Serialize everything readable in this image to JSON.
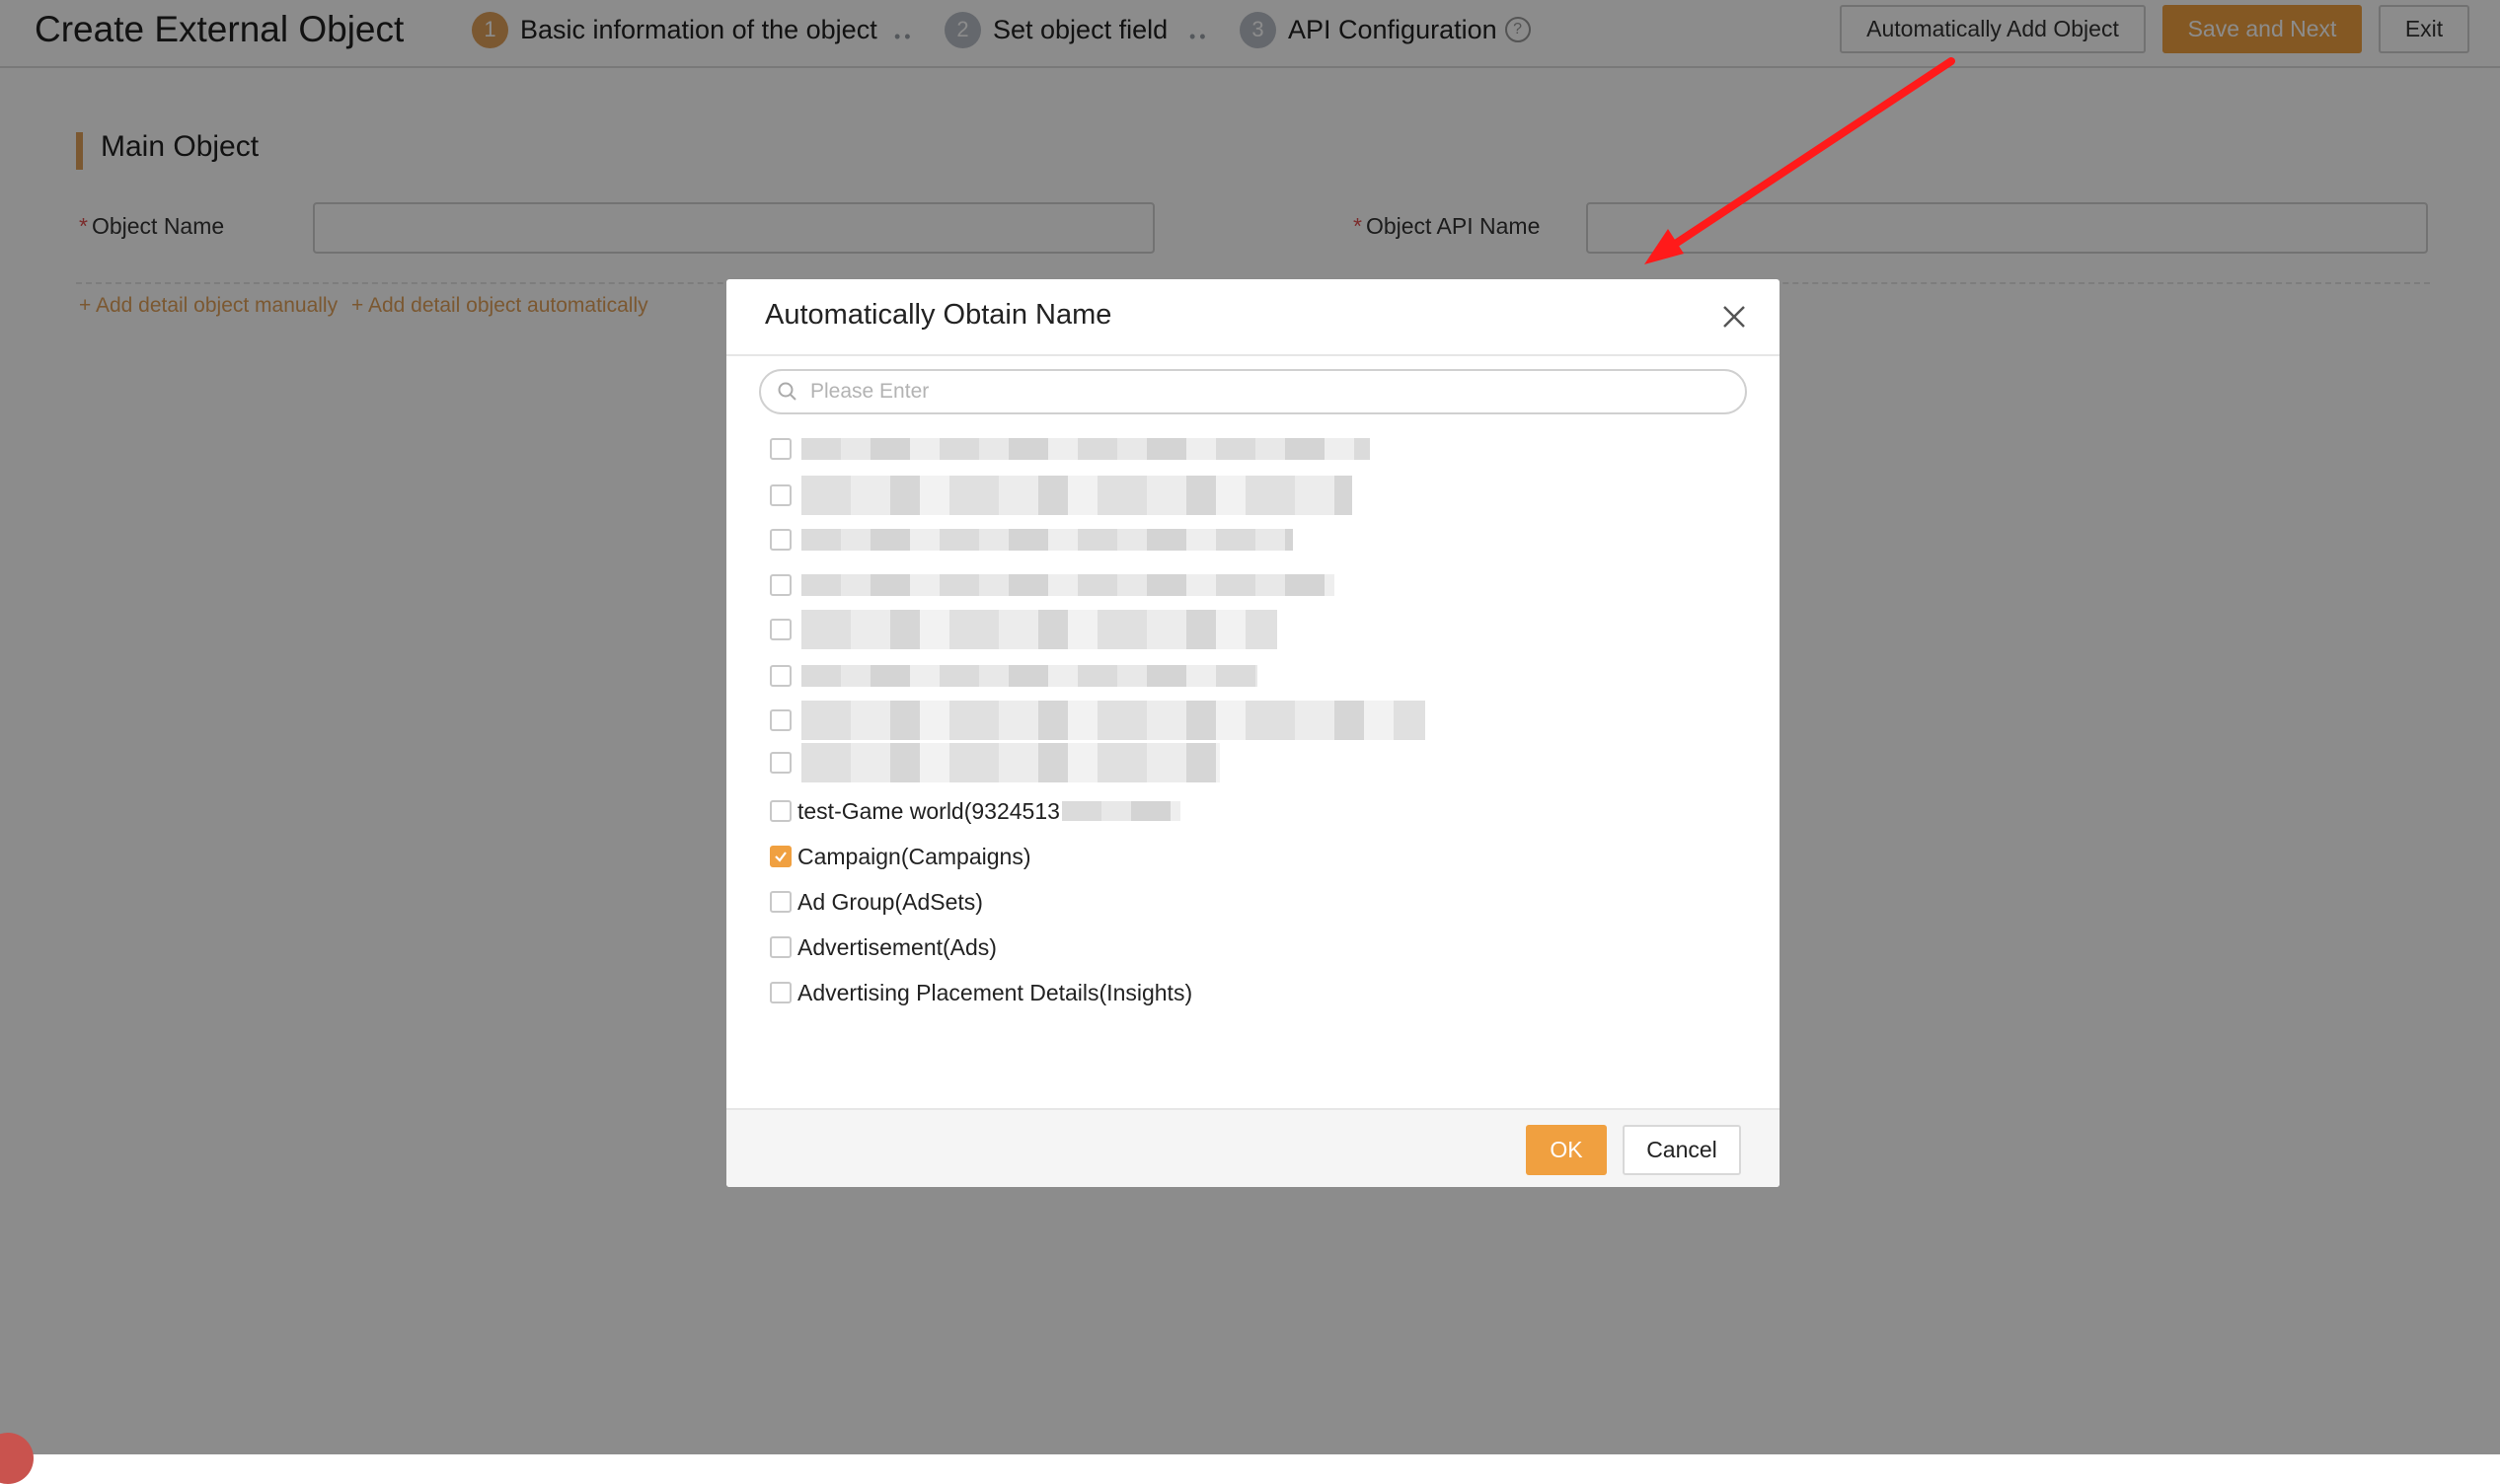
{
  "page": {
    "title": "Create External Object",
    "steps": [
      {
        "num": "1",
        "label": "Basic information of the object"
      },
      {
        "num": "2",
        "label": "Set object field"
      },
      {
        "num": "3",
        "label": "API Configuration"
      }
    ],
    "toolbar": {
      "auto_add_label": "Automatically Add Object",
      "save_next_label": "Save and Next",
      "exit_label": "Exit"
    },
    "section_title": "Main Object",
    "object_name_label": "Object Name",
    "object_api_name_label": "Object API Name",
    "required_mark": "*",
    "add_manual_link": "+ Add detail object manually",
    "add_auto_link": "+ Add detail object automatically"
  },
  "dialog": {
    "title": "Automatically Obtain Name",
    "search_placeholder": "Please Enter",
    "options": [
      {
        "label": "test-Game world(9324513",
        "checked": false
      },
      {
        "label": "Campaign(Campaigns)",
        "checked": true
      },
      {
        "label": "Ad Group(AdSets)",
        "checked": false
      },
      {
        "label": "Advertisement(Ads)",
        "checked": false
      },
      {
        "label": "Advertising Placement Details(Insights)",
        "checked": false
      }
    ],
    "ok_label": "OK",
    "cancel_label": "Cancel"
  },
  "colors": {
    "accent": "#f0a040",
    "step_active": "#e0a05a",
    "arrow": "#ff1a1a"
  },
  "icons": [
    "help-icon",
    "close-icon",
    "search-icon",
    "checkmark-icon"
  ]
}
